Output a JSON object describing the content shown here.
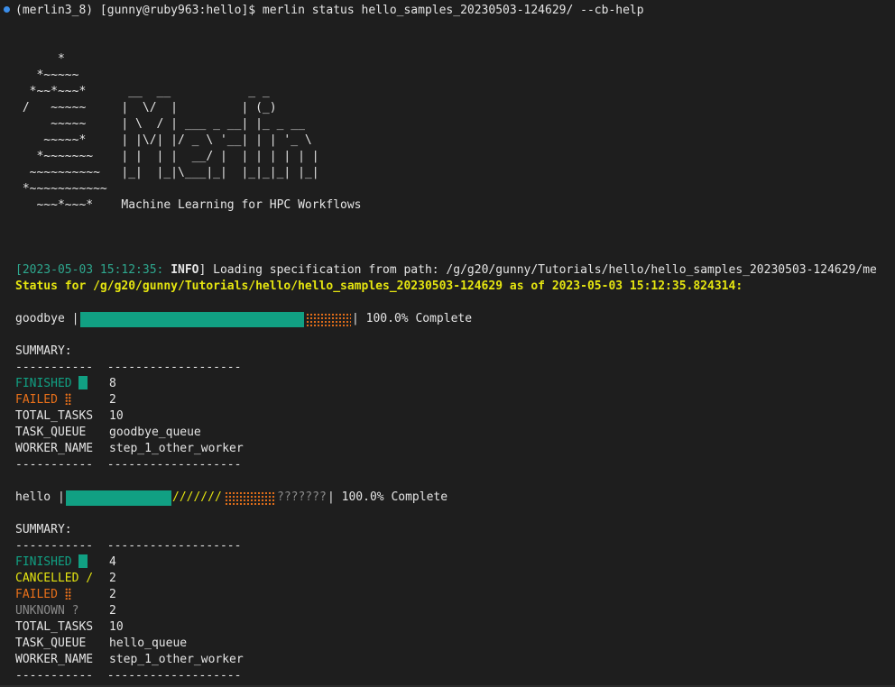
{
  "command": "(merlin3_8) [gunny@ruby963:hello]$ merlin status hello_samples_20230503-124629/ --cb-help",
  "ascii_art": [
    "      *",
    "   *~~~~~",
    "  *~~*~~~*      __  __           _ _",
    " /   ~~~~~     |  \\/  |         | (_)",
    "     ~~~~~     | \\  / | ___ _ __| |_ _ __",
    "    ~~~~~*     | |\\/| |/ _ \\ '__| | | '_ \\",
    "   *~~~~~~~    | |  | |  __/ |  | | | | | |",
    "  ~~~~~~~~~~   |_|  |_|\\___|_|  |_|_|_| |_|",
    " *~~~~~~~~~~~",
    "   ~~~*~~~*    Machine Learning for HPC Workflows"
  ],
  "log": {
    "timestamp": "[2023-05-03 15:12:35: ",
    "level": "INFO",
    "message": "] Loading specification from path: /g/g20/gunny/Tutorials/hello/hello_samples_20230503-124629/me"
  },
  "status_line": "Status for /g/g20/gunny/Tutorials/hello/hello_samples_20230503-124629 as of 2023-05-03 15:12:35.824314:",
  "colors": {
    "finished": "#11a083",
    "failed": "#e8701a",
    "cancelled": "#e5e510",
    "unknown": "#8a8a8a",
    "background": "#1e1e1e"
  },
  "steps": [
    {
      "name": "goodbye",
      "progress": {
        "finished": 0.8,
        "failed": 0.2
      },
      "bar_end": "| 100.0% Complete",
      "summary_header": "SUMMARY:",
      "divider": "-----------  -------------------",
      "rows": [
        {
          "key": "FINISHED",
          "value": "8"
        },
        {
          "key": "FAILED",
          "value": "2"
        },
        {
          "key": "TOTAL_TASKS",
          "value": "10"
        },
        {
          "key": "TASK_QUEUE",
          "value": "goodbye_queue"
        },
        {
          "key": "WORKER_NAME",
          "value": "step_1_other_worker"
        }
      ]
    },
    {
      "name": "hello",
      "progress": {
        "finished": 0.4,
        "cancelled": 0.2,
        "failed": 0.2,
        "unknown": 0.2
      },
      "cancelled_chars": "///////",
      "unknown_chars": "???????",
      "bar_end": "| 100.0% Complete",
      "summary_header": "SUMMARY:",
      "divider": "-----------  -------------------",
      "rows": [
        {
          "key": "FINISHED",
          "value": "4"
        },
        {
          "key": "CANCELLED /",
          "value": "2"
        },
        {
          "key": "FAILED",
          "value": "2"
        },
        {
          "key": "UNKNOWN ?",
          "value": "2"
        },
        {
          "key": "TOTAL_TASKS",
          "value": "10"
        },
        {
          "key": "TASK_QUEUE",
          "value": "hello_queue"
        },
        {
          "key": "WORKER_NAME",
          "value": "step_1_other_worker"
        }
      ]
    }
  ]
}
